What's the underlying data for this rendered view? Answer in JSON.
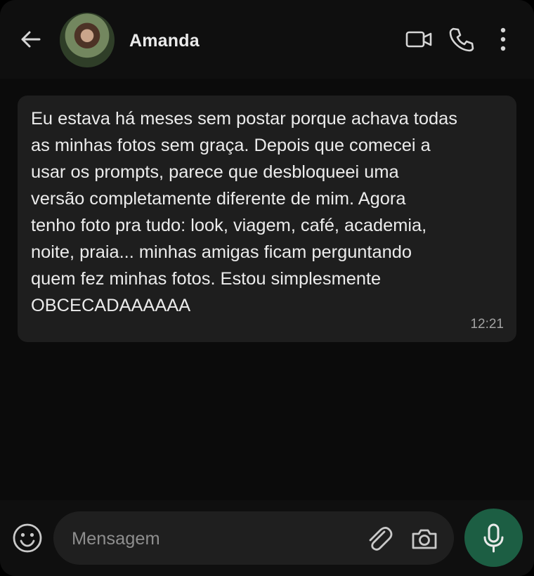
{
  "header": {
    "contact_name": "Amanda",
    "icons": [
      "back-arrow-icon",
      "video-call-icon",
      "voice-call-icon",
      "more-options-icon"
    ]
  },
  "chat": {
    "message": {
      "text": "Eu estava há meses sem postar porque achava todas\nas minhas fotos sem graça. Depois que comecei a\nusar os prompts, parece que desbloqueei uma\nversão completamente diferente de mim. Agora\ntenho foto pra tudo: look, viagem, café, academia,\nnoite, praia... minhas amigas ficam perguntando\nquem fez minhas fotos. Estou simplesmente\nOBCECADAAAAAA",
      "time": "12:21"
    }
  },
  "footer": {
    "placeholder": "Mensagem",
    "value": "",
    "icons": [
      "emoji-icon",
      "attach-icon",
      "camera-icon",
      "mic-icon"
    ]
  },
  "colors": {
    "background": "#0b0b0b",
    "bubble": "#1e1e1e",
    "mic_button": "#1c5e43"
  }
}
